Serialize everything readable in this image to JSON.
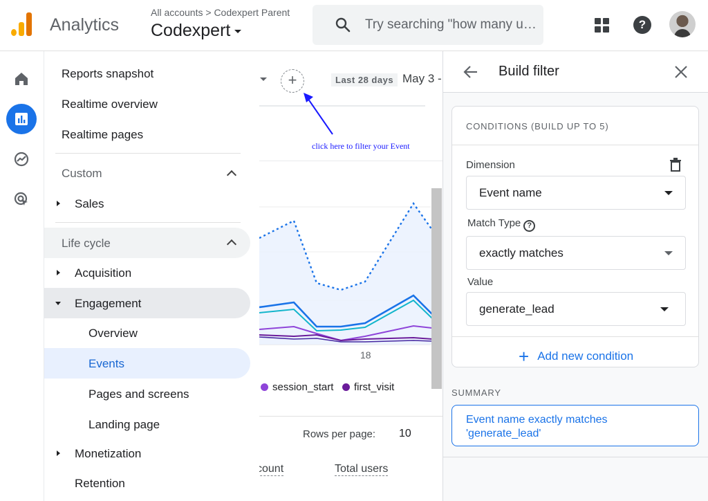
{
  "app": {
    "name": "Analytics",
    "breadcrumb": "All accounts > Codexpert Parent",
    "property": "Codexpert"
  },
  "search": {
    "placeholder": "Try searching \"how many users..."
  },
  "rail": {
    "items": [
      "home-icon",
      "reports-icon",
      "explore-icon",
      "advertising-icon"
    ],
    "active": 1
  },
  "nav": {
    "top_items": [
      "Reports snapshot",
      "Realtime overview",
      "Realtime pages"
    ],
    "custom_label": "Custom",
    "sales": "Sales",
    "lifecycle_label": "Life cycle",
    "acquisition": "Acquisition",
    "engagement": "Engagement",
    "engagement_children": [
      "Overview",
      "Events",
      "Pages and screens",
      "Landing page"
    ],
    "monetization": "Monetization",
    "retention": "Retention"
  },
  "report": {
    "date_chip": "Last 28 days",
    "date_range": "May 3 -",
    "annotation": "click here to filter your Event",
    "x_tick": "18",
    "legend": [
      {
        "name": "session_start",
        "color": "#8e44d9"
      },
      {
        "name": "first_visit",
        "color": "#6a1b9a"
      }
    ],
    "rows_per_page_label": "Rows per page:",
    "rows_per_page_value": "10",
    "col_count": "count",
    "col_total_users": "Total users"
  },
  "panel": {
    "title": "Build filter",
    "conditions_header": "CONDITIONS (BUILD UP TO 5)",
    "dimension_label": "Dimension",
    "dimension_value": "Event name",
    "match_type_label": "Match Type",
    "match_type_value": "exactly matches",
    "value_label": "Value",
    "value_value": "generate_lead",
    "add_condition": "Add new condition",
    "summary_label": "SUMMARY",
    "summary_line1": "Event name exactly matches",
    "summary_line2": "'generate_lead'"
  },
  "colors": {
    "accent": "#1a73e8",
    "annotation": "#1a1aff"
  }
}
